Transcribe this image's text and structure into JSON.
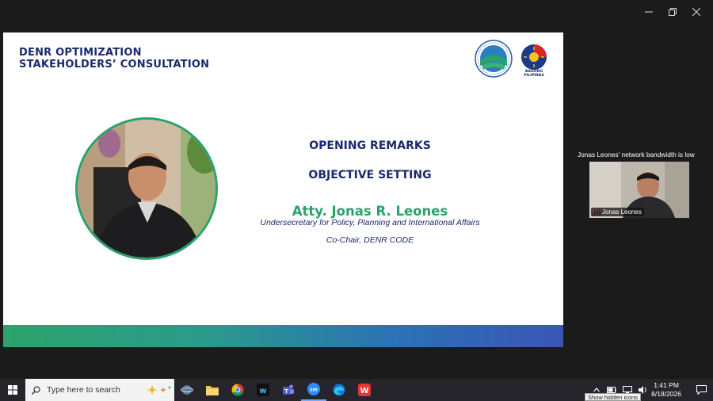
{
  "slide": {
    "header_line1": "DENR OPTIMIZATION",
    "header_line2": "STAKEHOLDERS’ CONSULTATION",
    "badge_text": "BAGONG PILIPINAS",
    "heading1": "OPENING REMARKS",
    "heading2": "OBJECTIVE SETTING",
    "speaker_name": "Atty. Jonas R. Leones",
    "speaker_title": "Undersecretary for Policy, Planning and International Affairs",
    "speaker_cochair": "Co-Chair, DENR CODE"
  },
  "participant": {
    "notice": "Jonas Leones' network bandwidth is low",
    "name": "Jonas Leones"
  },
  "taskbar": {
    "search_placeholder": "Type here to search",
    "time": "1:41 PM",
    "date": "8/18/2026",
    "tooltip": "Show hidden icons"
  },
  "colors": {
    "navy": "#1a2a6c",
    "green": "#2aa36b",
    "taskbar": "#25252b"
  }
}
